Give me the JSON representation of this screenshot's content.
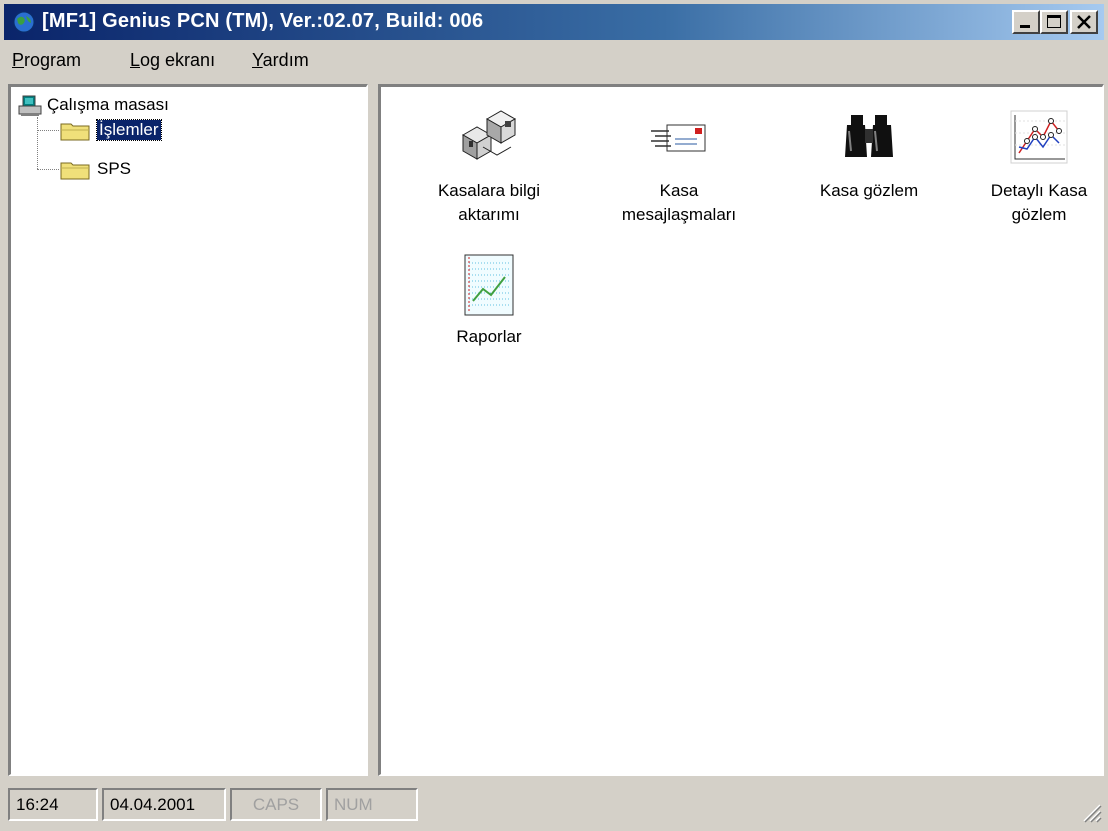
{
  "window": {
    "title": "[MF1] Genius PCN (TM), Ver.:02.07, Build: 006"
  },
  "menu": [
    {
      "underline": "P",
      "rest": "rogram"
    },
    {
      "underline": "L",
      "rest": "og ekranı"
    },
    {
      "underline": "Y",
      "rest": "ardım"
    }
  ],
  "tree": {
    "root": "Çalışma masası",
    "children": [
      "İşlemler",
      "SPS"
    ],
    "selected": "İşlemler"
  },
  "icons": [
    {
      "label": "Kasalara bilgi\naktarımı",
      "icon": "computers-transfer-icon"
    },
    {
      "label": "Kasa\nmesajlaşmaları",
      "icon": "envelope-message-icon"
    },
    {
      "label": "Kasa gözlem",
      "icon": "binoculars-icon"
    },
    {
      "label": "Detaylı Kasa\ngözlem",
      "icon": "line-graph-icon"
    },
    {
      "label": "Raporlar",
      "icon": "report-chart-icon"
    }
  ],
  "status": {
    "time": "16:24",
    "date": "04.04.2001",
    "caps": "CAPS",
    "num": "NUM"
  }
}
